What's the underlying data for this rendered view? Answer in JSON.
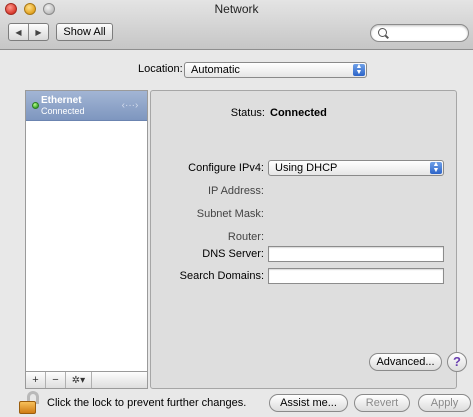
{
  "window": {
    "title": "Network"
  },
  "toolbar": {
    "back_glyph": "◀",
    "forward_glyph": "▶",
    "show_all_label": "Show All",
    "search_value": ""
  },
  "location": {
    "label": "Location:",
    "selected": "Automatic"
  },
  "sidebar": {
    "services": [
      {
        "name": "Ethernet",
        "status": "Connected",
        "status_color": "#3aa52c"
      }
    ],
    "add_glyph": "+",
    "remove_glyph": "−",
    "action_glyph": "✲▾"
  },
  "details": {
    "status_label": "Status:",
    "status_value": "Connected",
    "configure_label": "Configure IPv4:",
    "configure_value": "Using DHCP",
    "ip_label": "IP Address:",
    "mask_label": "Subnet Mask:",
    "router_label": "Router:",
    "dns_label": "DNS Server:",
    "dns_value": "",
    "search_domains_label": "Search Domains:",
    "search_domains_value": "",
    "advanced_label": "Advanced...",
    "help_glyph": "?"
  },
  "footer": {
    "lock_text": "Click the lock to prevent further changes.",
    "assist_label": "Assist me...",
    "revert_label": "Revert",
    "apply_label": "Apply"
  },
  "colors": {
    "selection": "#8aa0c6",
    "help_accent": "#6a3fb0",
    "popup_arrow": "#2d64c8"
  }
}
